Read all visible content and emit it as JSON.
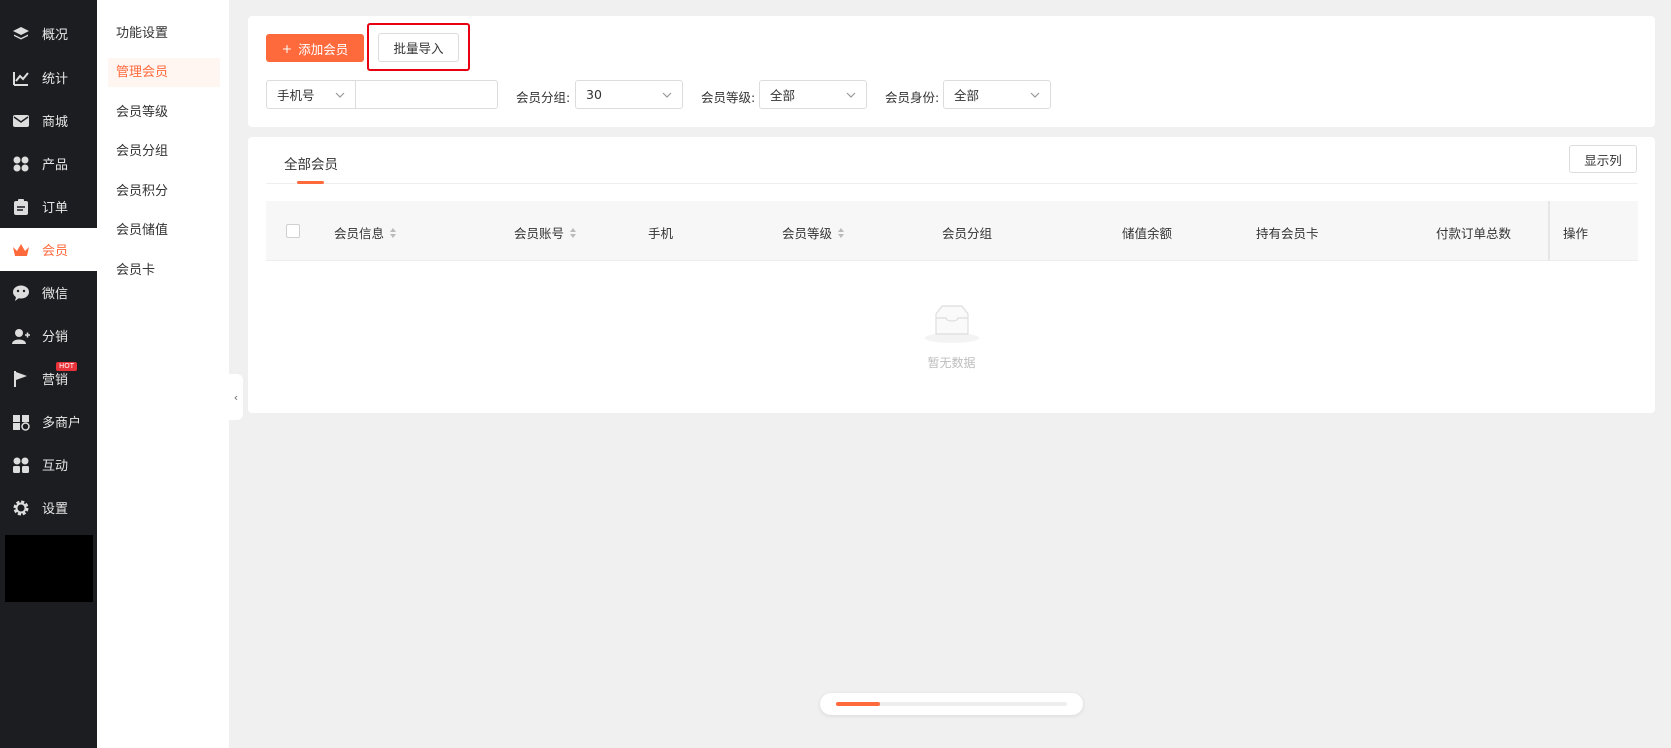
{
  "nav": {
    "items": [
      {
        "label": "概况",
        "icon": "layers-icon"
      },
      {
        "label": "统计",
        "icon": "chart-icon"
      },
      {
        "label": "商城",
        "icon": "mail-icon"
      },
      {
        "label": "产品",
        "icon": "grid-icon"
      },
      {
        "label": "订单",
        "icon": "clipboard-icon"
      },
      {
        "label": "会员",
        "icon": "crown-icon"
      },
      {
        "label": "微信",
        "icon": "wechat-icon"
      },
      {
        "label": "分销",
        "icon": "users-icon"
      },
      {
        "label": "营销",
        "icon": "flag-icon"
      },
      {
        "label": "多商户",
        "icon": "shop-icon"
      },
      {
        "label": "互动",
        "icon": "people-icon"
      },
      {
        "label": "设置",
        "icon": "gear-icon"
      }
    ],
    "hot_badge": "HOT",
    "active_index": 5
  },
  "submenu": {
    "items": [
      "功能设置",
      "管理会员",
      "会员等级",
      "会员分组",
      "会员积分",
      "会员储值",
      "会员卡"
    ],
    "active_index": 1
  },
  "toolbar": {
    "add_label": "添加会员",
    "import_label": "批量导入"
  },
  "filters": {
    "search_type": "手机号",
    "search_value": "",
    "group_label": "会员分组:",
    "group_value": "30",
    "level_label": "会员等级:",
    "level_value": "全部",
    "identity_label": "会员身份:",
    "identity_value": "全部"
  },
  "list": {
    "tab": "全部会员",
    "columns_button": "显示列",
    "headers": [
      "会员信息",
      "会员账号",
      "手机",
      "会员等级",
      "会员分组",
      "储值余额",
      "持有会员卡",
      "付款订单总数",
      "操作"
    ],
    "empty_text": "暂无数据"
  },
  "loader": {
    "progress": 0.19
  },
  "colors": {
    "accent": "#ff6a3d",
    "nav_bg": "#1c1d21",
    "highlight": "#e60012"
  }
}
